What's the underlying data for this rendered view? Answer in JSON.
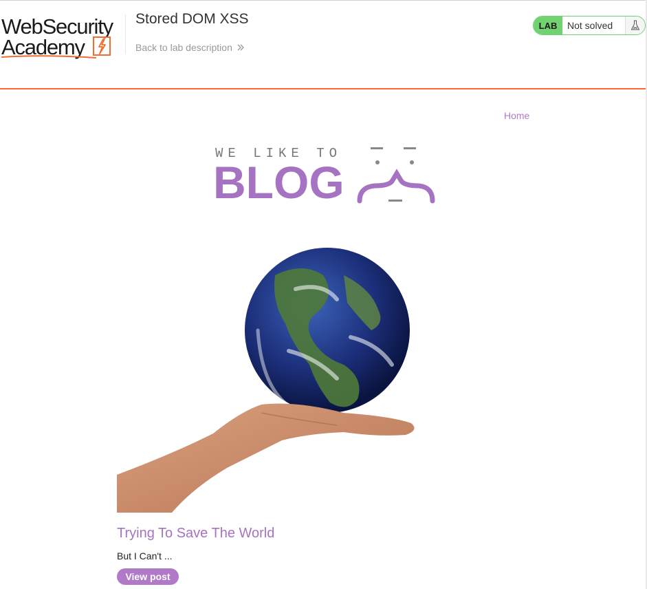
{
  "header": {
    "logo_line1": "WebSecurity",
    "logo_line2": "Academy",
    "lab_title": "Stored DOM XSS",
    "back_link": "Back to lab description",
    "status_badge_label": "LAB",
    "status_text": "Not solved"
  },
  "nav": {
    "home": "Home"
  },
  "banner": {
    "tagline": "WE LIKE TO",
    "blog_word": "BLOG"
  },
  "post": {
    "title": "Trying To Save The World",
    "summary": "But I Can't ...",
    "view_button": "View post"
  },
  "colors": {
    "accent_purple": "#a672c2",
    "header_rule_orange": "#ff6633",
    "status_green": "#70d36f"
  },
  "icons": [
    "lightning-bolt-icon",
    "chevron-double-right-icon",
    "flask-icon",
    "blog-face-icon"
  ]
}
